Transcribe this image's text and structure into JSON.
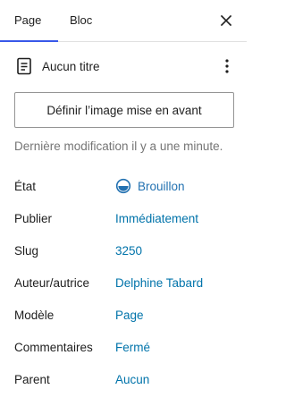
{
  "tabs": [
    {
      "label": "Page",
      "active": true
    },
    {
      "label": "Bloc",
      "active": false
    }
  ],
  "icons": {
    "close": "close-icon",
    "document": "page-document-icon",
    "more": "more-vertical-icon",
    "status": "draft-status-icon"
  },
  "document": {
    "title": "Aucun titre"
  },
  "featured_image": {
    "button_label": "Définir l’image mise en avant"
  },
  "last_modified": "Dernière modification il y a une minute.",
  "summary": [
    {
      "label": "État",
      "value": "Brouillon"
    },
    {
      "label": "Publier",
      "value": "Immédiatement"
    },
    {
      "label": "Slug",
      "value": "3250"
    },
    {
      "label": "Auteur/autrice",
      "value": "Delphine Tabard"
    },
    {
      "label": "Modèle",
      "value": "Page"
    },
    {
      "label": "Commentaires",
      "value": "Fermé"
    },
    {
      "label": "Parent",
      "value": "Aucun"
    }
  ],
  "colors": {
    "accent": "#3858e9",
    "link": "#0073aa",
    "muted": "#757575",
    "text": "#1e1e1e"
  }
}
